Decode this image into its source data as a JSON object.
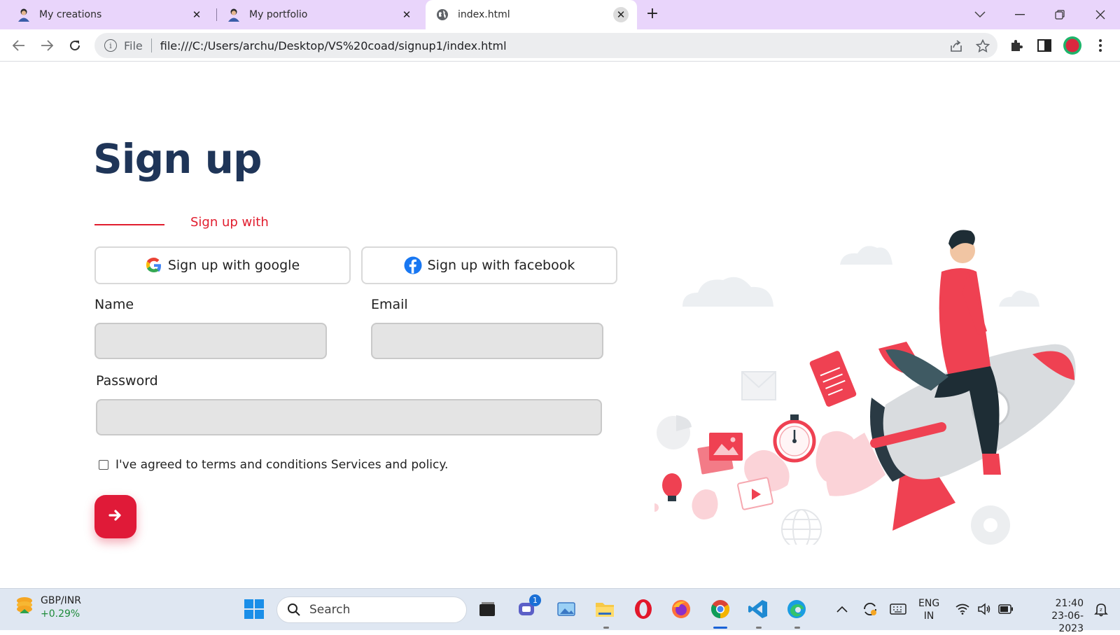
{
  "browser": {
    "tabs": [
      {
        "label": "My creations",
        "close": "✕"
      },
      {
        "label": "My portfolio",
        "close": "✕"
      },
      {
        "label": "index.html",
        "close": "✕"
      }
    ],
    "new_tab": "+",
    "address": {
      "scheme_label": "File",
      "url": "file:///C:/Users/archu/Desktop/VS%20coad/signup1/index.html"
    }
  },
  "page": {
    "title": "Sign up",
    "signup_with": "Sign up with",
    "google_button": "Sign up with google",
    "facebook_button": "Sign up with facebook",
    "name_label": "Name",
    "email_label": "Email",
    "password_label": "Password",
    "name_value": "",
    "email_value": "",
    "password_value": "",
    "terms_text": "I've agreed to terms and conditions Services and policy.",
    "terms_checked": false,
    "submit_icon": "arrow-right-icon",
    "colors": {
      "title": "#1f3558",
      "accent": "#e11d2e",
      "submit": "#e01a38"
    }
  },
  "taskbar": {
    "widget_name": "GBP/INR",
    "widget_change": "+0.29%",
    "search_placeholder": "Search",
    "chat_badge": "1",
    "lang_top": "ENG",
    "lang_bottom": "IN",
    "time": "21:40",
    "date": "23-06-2023"
  }
}
